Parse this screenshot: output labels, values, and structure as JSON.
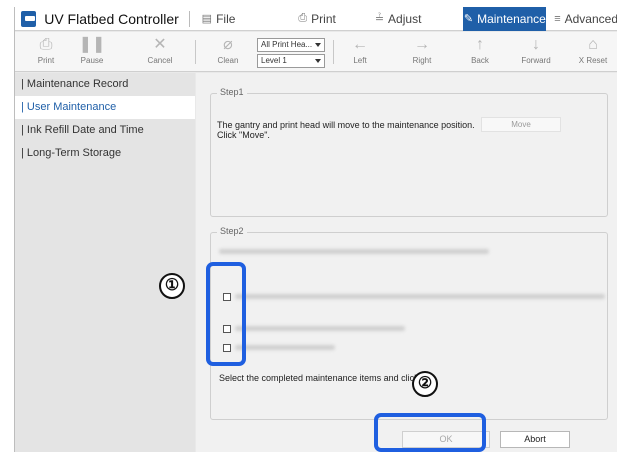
{
  "window": {
    "app_title": "UV Flatbed Controller",
    "menu": {
      "file": "File",
      "print": "Print",
      "adjust": "Adjust",
      "maintenance": "Maintenance",
      "advanced": "Advanced"
    }
  },
  "toolbar": {
    "print": "Print",
    "pause": "Pause",
    "cancel": "Cancel",
    "clean": "Clean",
    "head_select": "All Print Hea...",
    "level_select": "Level 1",
    "left": "Left",
    "right": "Right",
    "back": "Back",
    "forward": "Forward",
    "x_reset": "X Reset"
  },
  "sidebar": {
    "items": [
      {
        "label": "| Maintenance Record"
      },
      {
        "label": "| User Maintenance"
      },
      {
        "label": "| Ink Refill Date and Time"
      },
      {
        "label": "| Long-Term Storage"
      }
    ],
    "selected_index": 1
  },
  "step1": {
    "title": "Step1",
    "text": "The gantry and print head will move to the maintenance position. Click \"Move\".",
    "move_button": "Move"
  },
  "step2": {
    "title": "Step2",
    "select_text": "Select the completed maintenance items and click \"\"."
  },
  "dialog": {
    "ok": "OK",
    "abort": "Abort"
  },
  "callouts": {
    "one": "①",
    "two": "②"
  },
  "colors": {
    "accent": "#1f5fa8",
    "highlight": "#1f5fe0"
  },
  "icons": {
    "print": "printer-icon",
    "pause": "pause-icon",
    "cancel": "cancel-icon",
    "clean": "clean-icon",
    "left": "arrow-left-icon",
    "right": "arrow-right-icon",
    "back": "arrow-up-icon",
    "forward": "arrow-down-icon",
    "x_reset": "home-icon"
  }
}
